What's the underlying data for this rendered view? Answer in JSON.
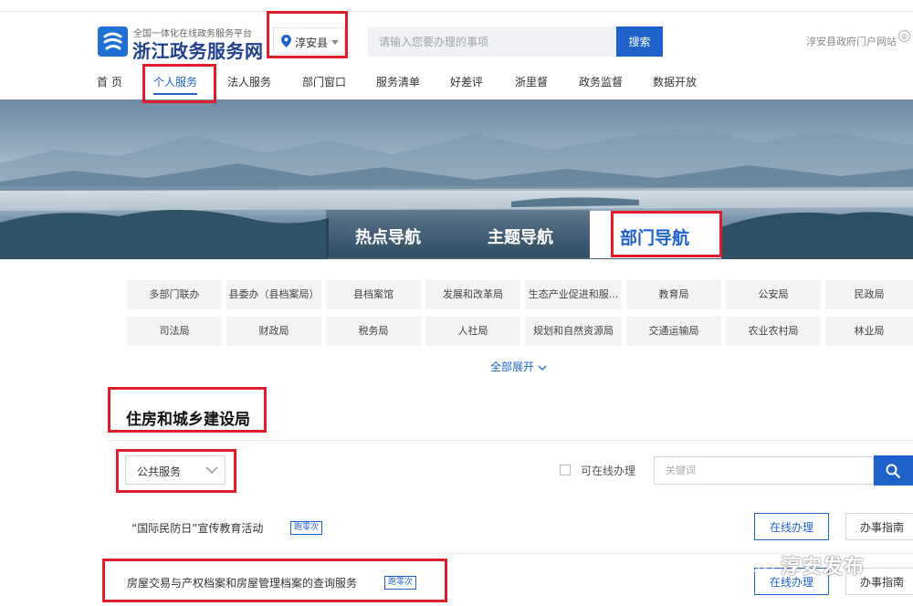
{
  "header": {
    "logo_subtitle": "全国一体化在线政务服务平台",
    "logo_title": "浙江政务服务网",
    "region": "淳安县",
    "search_placeholder": "请输入您要办理的事项",
    "search_button": "搜索",
    "portal_link": "淳安县政府门户网站"
  },
  "nav": {
    "items": [
      "首 页",
      "个人服务",
      "法人服务",
      "部门窗口",
      "服务清单",
      "好差评",
      "浙里督",
      "政务监督",
      "数据开放"
    ],
    "active": "个人服务"
  },
  "banner_tabs": {
    "items": [
      "热点导航",
      "主题导航",
      "部门导航"
    ],
    "active": "部门导航"
  },
  "departments": [
    "多部门联办",
    "县委办（县档案局）",
    "县档案馆",
    "发展和改革局",
    "生态产业促进和服...",
    "教育局",
    "公安局",
    "民政局",
    "司法局",
    "财政局",
    "税务局",
    "人社局",
    "规划和自然资源局",
    "交通运输局",
    "农业农村局",
    "林业局"
  ],
  "expand_all": "全部展开",
  "section": {
    "title": "住房和城乡建设局",
    "filter_select": "公共服务",
    "online_checkbox_label": "可在线办理",
    "keyword_placeholder": "关键词"
  },
  "services": [
    {
      "name": "“国际民防日”宣传教育活动",
      "badge": "跑零次",
      "online_button": "在线办理",
      "guide_button": "办事指南"
    },
    {
      "name": "房屋交易与产权档案和房屋管理档案的查询服务",
      "badge": "跑零次",
      "online_button": "在线办理",
      "guide_button": "办事指南"
    }
  ],
  "watermark": "淳安发布",
  "colors": {
    "primary": "#1e62c9",
    "highlight": "#e11c2a"
  }
}
